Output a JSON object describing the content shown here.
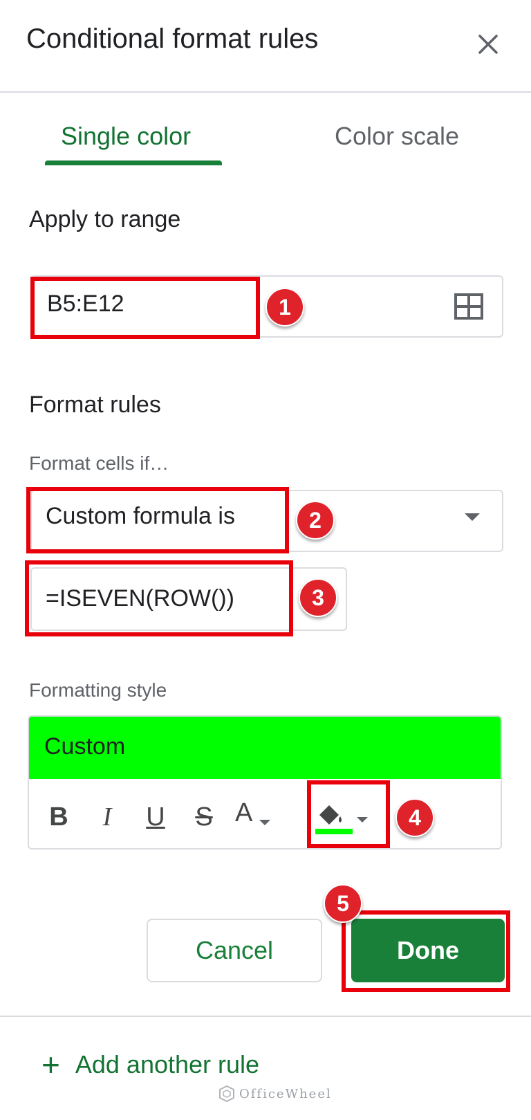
{
  "header": {
    "title": "Conditional format rules",
    "close_icon": "close-icon"
  },
  "tabs": [
    {
      "label": "Single color",
      "active": true
    },
    {
      "label": "Color scale",
      "active": false
    }
  ],
  "apply_range": {
    "heading": "Apply to range",
    "value": "B5:E12",
    "icon": "grid-select-icon"
  },
  "format_rules": {
    "heading": "Format rules",
    "condition_label": "Format cells if…",
    "condition_value": "Custom formula is",
    "formula_value": "=ISEVEN(ROW())"
  },
  "formatting_style": {
    "label": "Formatting style",
    "preview_text": "Custom",
    "preview_color": "#00ff00",
    "fill_color": "#00ff00",
    "tools": {
      "bold": "B",
      "italic": "I",
      "underline": "U",
      "strikethrough": "S",
      "text_color": "A"
    }
  },
  "buttons": {
    "cancel": "Cancel",
    "done": "Done"
  },
  "add_rule": {
    "label": "Add another rule"
  },
  "annotations": {
    "badge1": "1",
    "badge2": "2",
    "badge3": "3",
    "badge4": "4",
    "badge5": "5"
  },
  "watermark": "OfficeWheel",
  "colors": {
    "accent": "#188038",
    "annotation_red": "#e8000a"
  }
}
